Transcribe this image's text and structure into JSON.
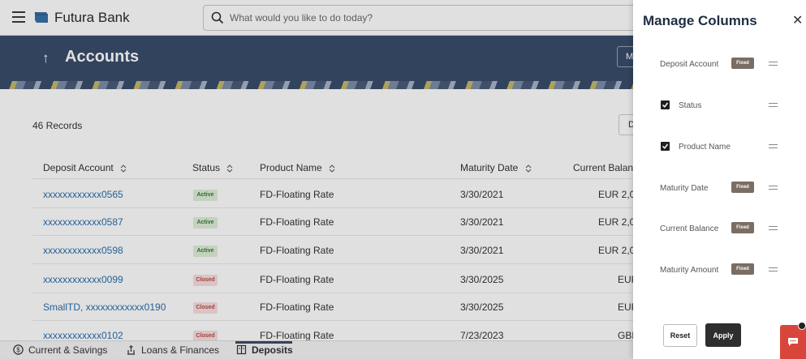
{
  "app": {
    "bank_name": "Futura Bank"
  },
  "search": {
    "placeholder": "What would you like to do today?"
  },
  "header": {
    "title": "Accounts",
    "manage_stub": "M"
  },
  "content": {
    "records": "46 Records",
    "download_stub": "D"
  },
  "table": {
    "columns": [
      "Deposit Account",
      "Status",
      "Product Name",
      "Maturity Date",
      "Current Balanc"
    ],
    "rows": [
      {
        "account": "xxxxxxxxxxxx0565",
        "status": "Active",
        "product": "FD-Floating Rate",
        "maturity": "3/30/2021",
        "balance": "EUR 2,0"
      },
      {
        "account": "xxxxxxxxxxxx0587",
        "status": "Active",
        "product": "FD-Floating Rate",
        "maturity": "3/30/2021",
        "balance": "EUR 2,0"
      },
      {
        "account": "xxxxxxxxxxxx0598",
        "status": "Active",
        "product": "FD-Floating Rate",
        "maturity": "3/30/2021",
        "balance": "EUR 2,0"
      },
      {
        "account": "xxxxxxxxxxxx0099",
        "status": "Closed",
        "product": "FD-Floating Rate",
        "maturity": "3/30/2025",
        "balance": "EUF"
      },
      {
        "account": "SmallTD, xxxxxxxxxxxx0190",
        "status": "Closed",
        "product": "FD-Floating Rate",
        "maturity": "3/30/2025",
        "balance": "EUF"
      },
      {
        "account": "xxxxxxxxxxxx0102",
        "status": "Closed",
        "product": "FD-Floating Rate",
        "maturity": "7/23/2023",
        "balance": "GBF"
      }
    ]
  },
  "bottom_nav": {
    "items": [
      "Current & Savings",
      "Loans & Finances",
      "Deposits"
    ],
    "active": "Deposits"
  },
  "drawer": {
    "title": "Manage Columns",
    "fixed_label": "Fixed",
    "columns": [
      {
        "label": "Deposit Account",
        "fixed": true,
        "checked": false
      },
      {
        "label": "Status",
        "fixed": false,
        "checked": true
      },
      {
        "label": "Product Name",
        "fixed": false,
        "checked": true
      },
      {
        "label": "Maturity Date",
        "fixed": true,
        "checked": false
      },
      {
        "label": "Current Balance",
        "fixed": true,
        "checked": false
      },
      {
        "label": "Maturity Amount",
        "fixed": true,
        "checked": false
      }
    ],
    "reset_label": "Reset",
    "apply_label": "Apply"
  },
  "colors": {
    "header_bg": "#3a4d6a",
    "link": "#2a6ead",
    "active_badge": "#3c763d",
    "closed_badge": "#b94a48",
    "fixed_badge": "#7a6d63",
    "chat": "#d8463b"
  },
  "icons": [
    "menu-icon",
    "bank-logo-icon",
    "search-icon",
    "back-arrow-icon",
    "sort-icon",
    "close-icon",
    "drag-handle-icon",
    "checkbox-icon",
    "chat-icon",
    "savings-icon",
    "loans-icon",
    "deposits-icon"
  ]
}
